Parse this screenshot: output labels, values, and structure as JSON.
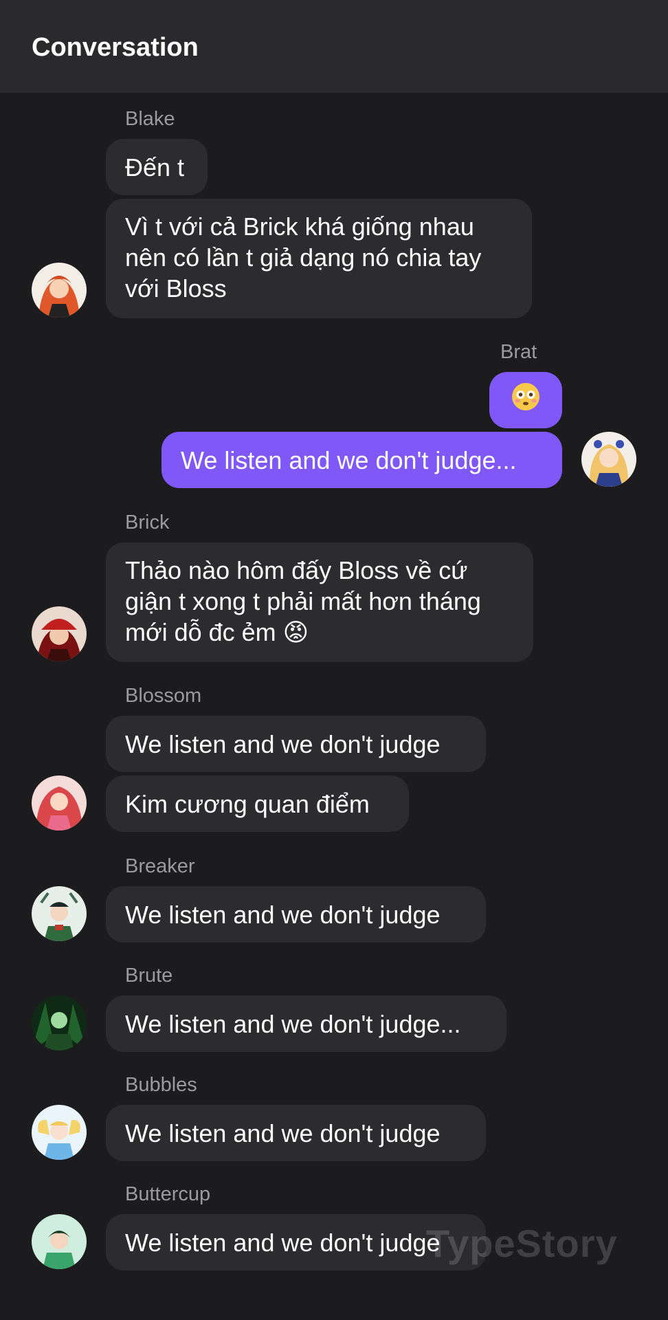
{
  "header": {
    "title": "Conversation"
  },
  "messages": [
    {
      "sender": "Blake",
      "bubbles": [
        "Đến t",
        "Vì t với cả Brick khá giống nhau\nnên có lần t giả dạng nó chia tay\nvới Bloss"
      ],
      "avatar": "blake-avatar"
    },
    {
      "sender": "Brat",
      "bubbles": [
        "😳",
        "We listen and we don't judge..."
      ],
      "avatar": "brat-avatar",
      "mine": true
    },
    {
      "sender": "Brick",
      "bubbles": [
        "Thảo nào hôm đấy Bloss về cứ\ngiận t xong t phải mất hơn tháng\nmới dỗ đc ẻm 😡"
      ],
      "avatar": "brick-avatar"
    },
    {
      "sender": "Blossom",
      "bubbles": [
        "We listen and we don't judge",
        "Kim cương quan điểm"
      ],
      "avatar": "blossom-avatar"
    },
    {
      "sender": "Breaker",
      "bubbles": [
        "We listen and we don't judge"
      ],
      "avatar": "breaker-avatar"
    },
    {
      "sender": "Brute",
      "bubbles": [
        "We listen and we don't judge..."
      ],
      "avatar": "brute-avatar"
    },
    {
      "sender": "Bubbles",
      "bubbles": [
        "We listen and we don't judge"
      ],
      "avatar": "bubbles-avatar"
    },
    {
      "sender": "Buttercup",
      "bubbles": [
        "We listen and we don't judge"
      ],
      "avatar": "buttercup-avatar"
    }
  ],
  "watermark": "TypeStory",
  "colors": {
    "background": "#1c1c1e",
    "header": "#2a2a2c",
    "bubble": "#2c2c2e",
    "mine_bubble": "#8058f8",
    "name": "#9a9aa0"
  }
}
